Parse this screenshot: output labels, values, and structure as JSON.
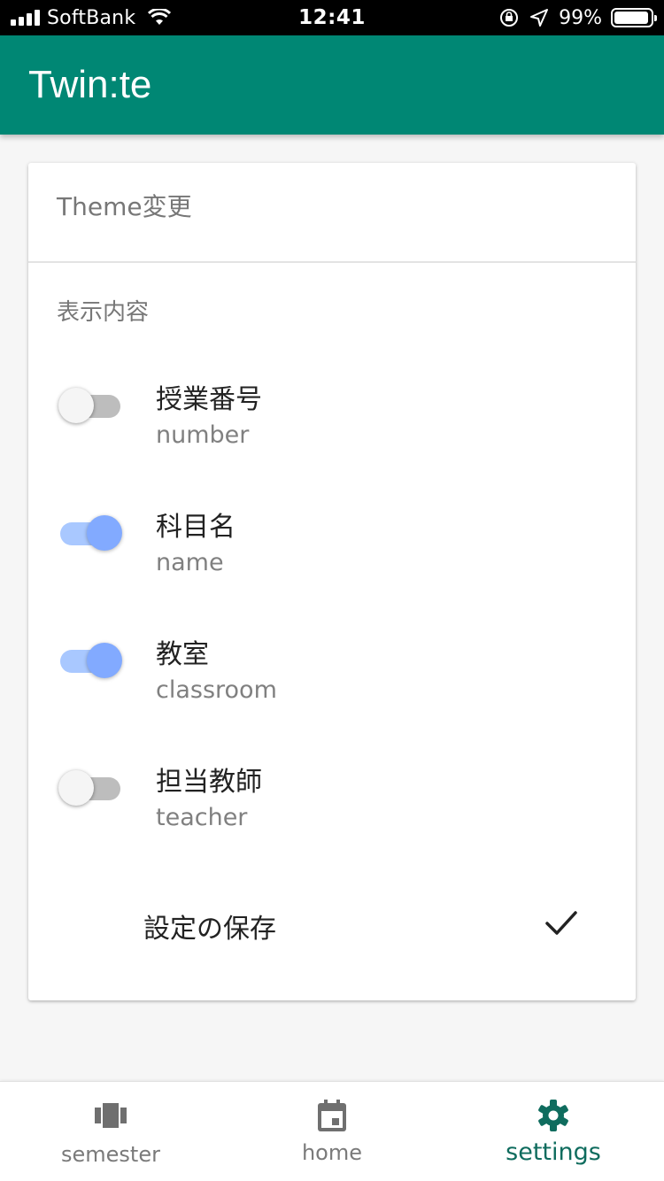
{
  "status_bar": {
    "carrier": "SoftBank",
    "time": "12:41",
    "battery": "99%",
    "icons": [
      "signal-icon",
      "wifi-icon",
      "orientation-lock-icon",
      "location-arrow-icon",
      "battery-icon"
    ]
  },
  "app_bar": {
    "title": "Twin:te",
    "color": "#008774"
  },
  "card": {
    "theme_label": "Theme変更",
    "section_label": "表示内容",
    "settings": [
      {
        "title": "授業番号",
        "subtitle": "number",
        "enabled": false
      },
      {
        "title": "科目名",
        "subtitle": "name",
        "enabled": true
      },
      {
        "title": "教室",
        "subtitle": "classroom",
        "enabled": true
      },
      {
        "title": "担当教師",
        "subtitle": "teacher",
        "enabled": false
      }
    ],
    "save_label": "設定の保存",
    "save_icon": "check-icon"
  },
  "bottom_nav": {
    "items": [
      {
        "label": "semester",
        "icon": "semester-icon",
        "active": false
      },
      {
        "label": "home",
        "icon": "calendar-icon",
        "active": false
      },
      {
        "label": "settings",
        "icon": "gear-icon",
        "active": true
      }
    ],
    "active_color": "#0f6c5e"
  },
  "colors": {
    "switch_on_thumb": "#82aaff",
    "switch_on_track": "#a9c8ff",
    "switch_off_track": "#bdbdbd"
  }
}
